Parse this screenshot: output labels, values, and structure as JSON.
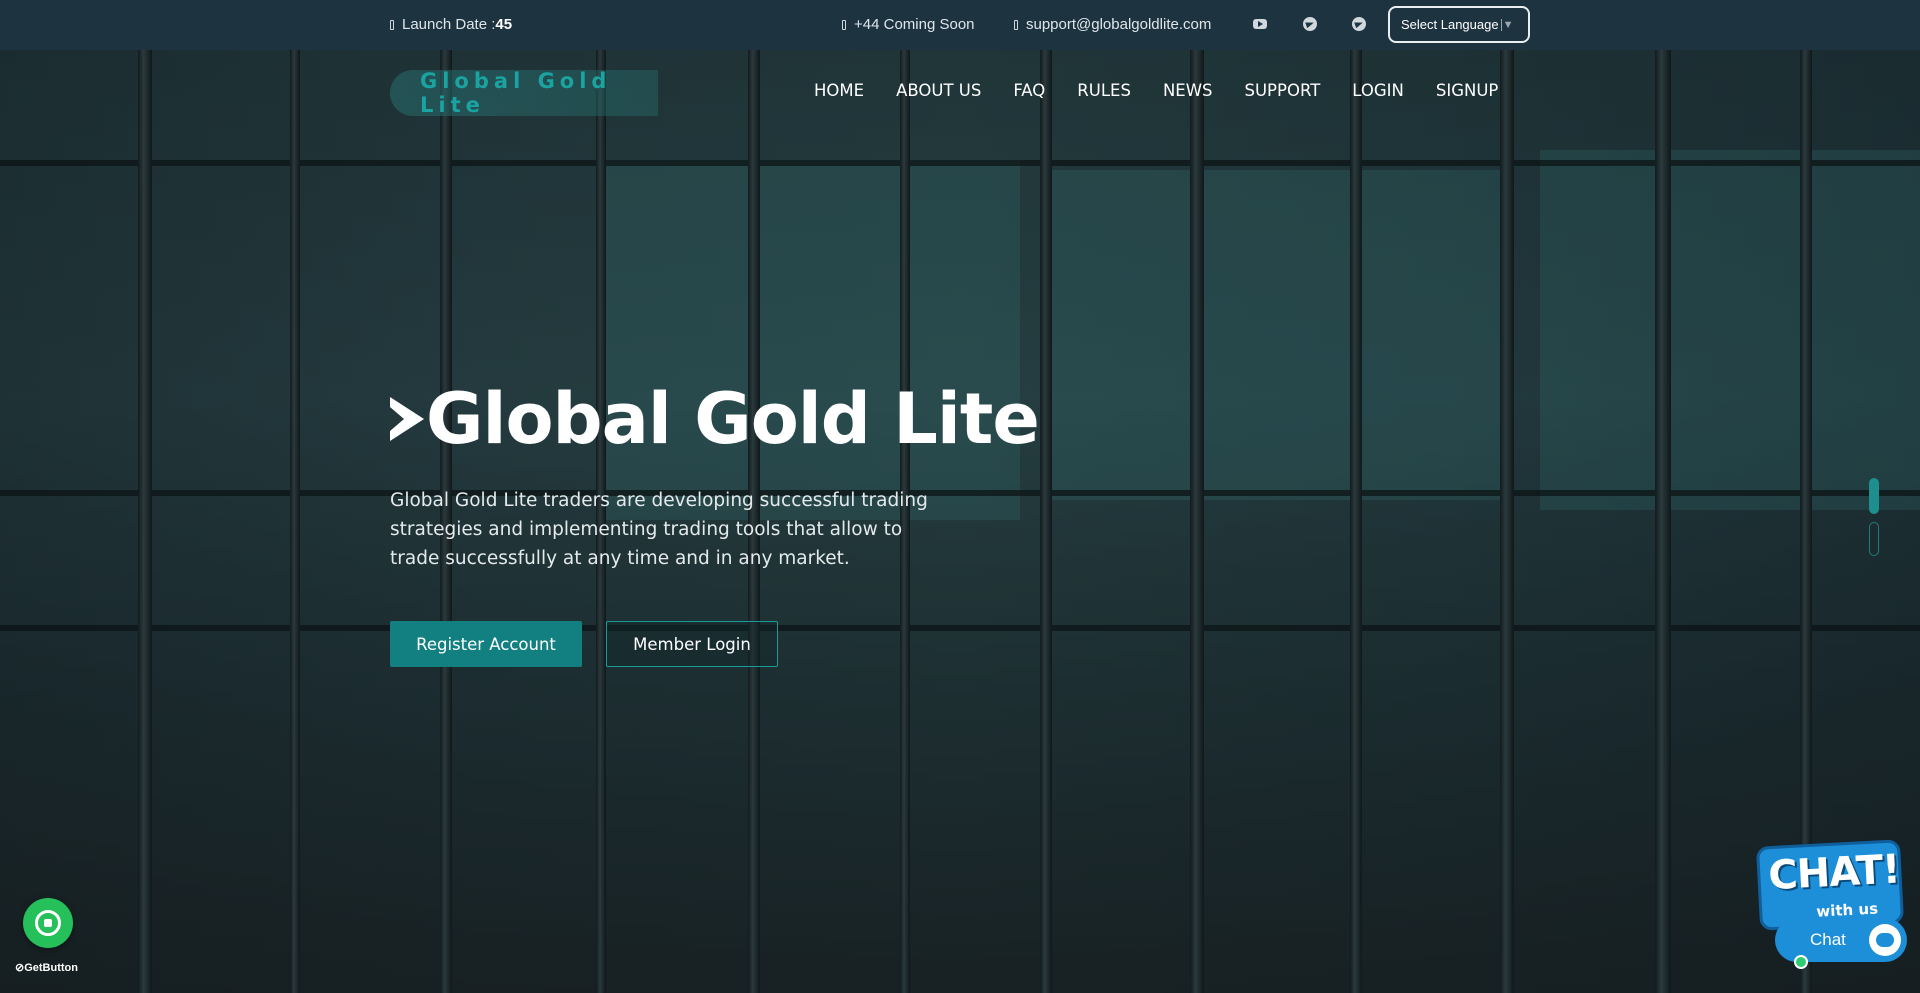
{
  "topbar": {
    "launch_label": "Launch Date :",
    "launch_value": "45",
    "phone": "+44 Coming Soon",
    "email": "support@globalgoldlite.com",
    "social": [
      "youtube-icon",
      "telegram-icon",
      "telegram-icon"
    ],
    "language_select": "Select Language"
  },
  "header": {
    "logo_text": "Global Gold Lite",
    "nav": [
      "HOME",
      "ABOUT US",
      "FAQ",
      "RULES",
      "NEWS",
      "SUPPORT",
      "LOGIN",
      "SIGNUP"
    ]
  },
  "hero": {
    "title": "Global Gold Lite",
    "description": "Global Gold Lite traders are developing successful trading strategies and implementing trading tools that allow to trade successfully at any time and in any market.",
    "register_button": "Register Account",
    "login_button": "Member Login"
  },
  "widgets": {
    "getbutton_label": "GetButton",
    "chat_badge_big": "CHAT!",
    "chat_badge_small": "with us",
    "chat_label": "Chat"
  },
  "colors": {
    "accent": "#128080",
    "topbar_bg": "#1e3340",
    "logo_text": "#1aa3a0",
    "whatsapp": "#25c05a",
    "chat_blue": "#1d8fd8"
  }
}
